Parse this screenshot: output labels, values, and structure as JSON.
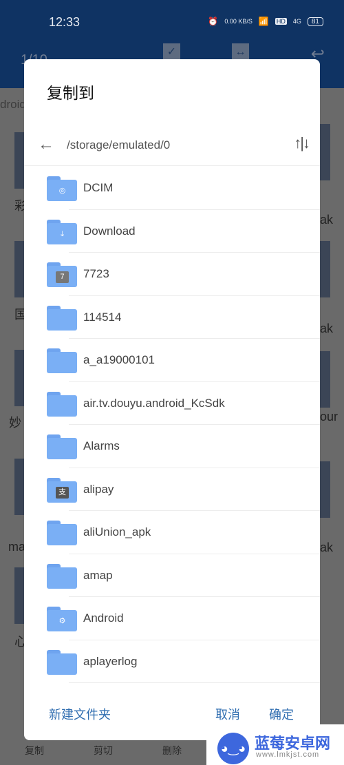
{
  "status_bar": {
    "time": "12:33",
    "net_speed": "0.00 KB/S",
    "hd": "HD",
    "signal": "4G",
    "battery": "81"
  },
  "background": {
    "count": "1/10",
    "breadcrumb": "droid",
    "left_labels": [
      "彩",
      "国",
      "妙",
      "ma",
      "心"
    ],
    "right_labels": [
      "ak",
      "ak",
      "our",
      "ak"
    ],
    "bottom_actions": [
      "复制",
      "剪切",
      "删除"
    ]
  },
  "dialog": {
    "title": "复制到",
    "path": "/storage/emulated/0",
    "folders": [
      {
        "name": "DCIM",
        "icon": "camera"
      },
      {
        "name": "Download",
        "icon": "download"
      },
      {
        "name": "7723",
        "icon": "app-7723"
      },
      {
        "name": "114514",
        "icon": "folder"
      },
      {
        "name": "a_a19000101",
        "icon": "folder"
      },
      {
        "name": "air.tv.douyu.android_KcSdk",
        "icon": "folder"
      },
      {
        "name": "Alarms",
        "icon": "folder"
      },
      {
        "name": "alipay",
        "icon": "alipay"
      },
      {
        "name": "aliUnion_apk",
        "icon": "folder"
      },
      {
        "name": "amap",
        "icon": "folder"
      },
      {
        "name": "Android",
        "icon": "gear"
      },
      {
        "name": "aplayerlog",
        "icon": "folder"
      }
    ],
    "new_folder": "新建文件夹",
    "cancel": "取消",
    "confirm": "确定"
  },
  "watermark": {
    "name": "蓝莓安卓网",
    "url": "www.lmkjst.com"
  },
  "colors": {
    "accent": "#2f6db0",
    "folder": "#7aaff5",
    "status_bar": "#0f3363"
  }
}
